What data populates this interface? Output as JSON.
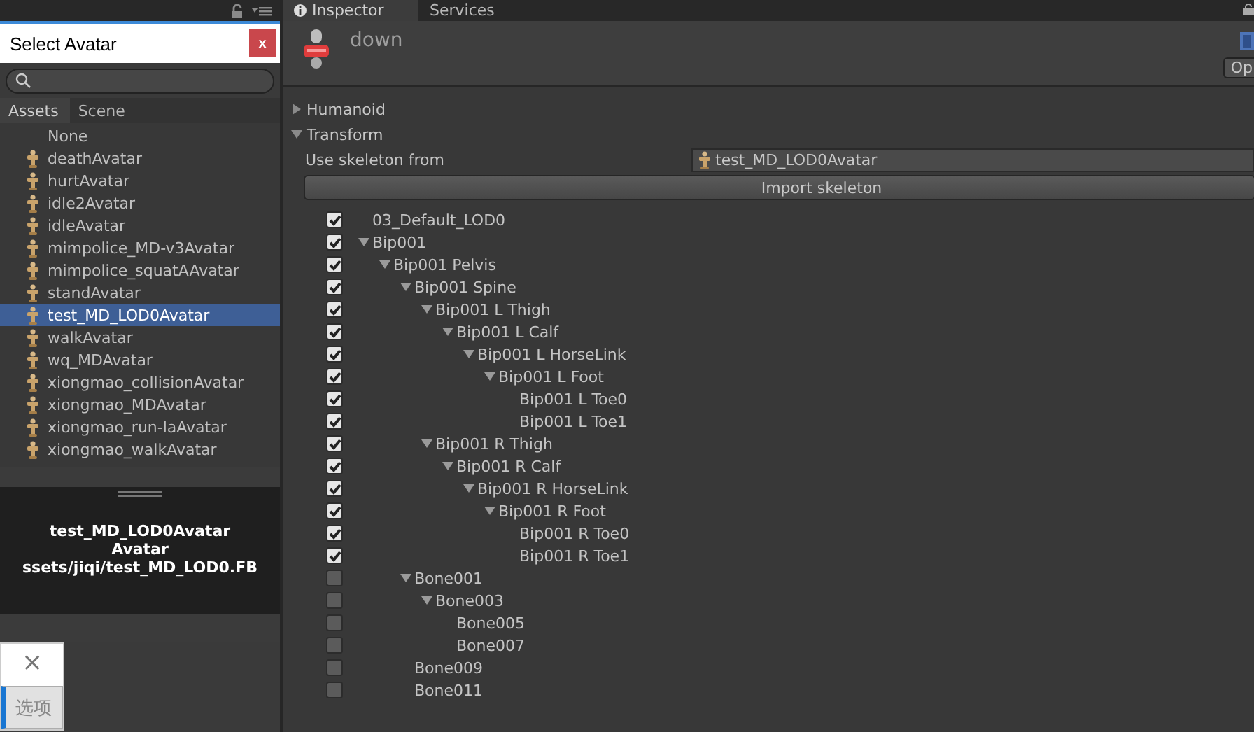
{
  "picker": {
    "title": "Select Avatar",
    "close": "x",
    "tabs": [
      {
        "label": "Assets",
        "selected": true
      },
      {
        "label": "Scene",
        "selected": false
      }
    ],
    "items": [
      {
        "label": "None",
        "kind": "none",
        "selected": false
      },
      {
        "label": "deathAvatar",
        "kind": "avatar",
        "selected": false
      },
      {
        "label": "hurtAvatar",
        "kind": "avatar",
        "selected": false
      },
      {
        "label": "idle2Avatar",
        "kind": "avatar",
        "selected": false
      },
      {
        "label": "idleAvatar",
        "kind": "avatar",
        "selected": false
      },
      {
        "label": "mimpolice_MD-v3Avatar",
        "kind": "avatar",
        "selected": false
      },
      {
        "label": "mimpolice_squatAAvatar",
        "kind": "avatar",
        "selected": false
      },
      {
        "label": "standAvatar",
        "kind": "avatar",
        "selected": false
      },
      {
        "label": "test_MD_LOD0Avatar",
        "kind": "avatar",
        "selected": true
      },
      {
        "label": "walkAvatar",
        "kind": "avatar",
        "selected": false
      },
      {
        "label": "wq_MDAvatar",
        "kind": "avatar",
        "selected": false
      },
      {
        "label": "xiongmao_collisionAvatar",
        "kind": "avatar",
        "selected": false
      },
      {
        "label": "xiongmao_MDAvatar",
        "kind": "avatar",
        "selected": false
      },
      {
        "label": "xiongmao_run-laAvatar",
        "kind": "avatar",
        "selected": false
      },
      {
        "label": "xiongmao_walkAvatar",
        "kind": "avatar",
        "selected": false
      }
    ],
    "preview": [
      "test_MD_LOD0Avatar",
      "Avatar",
      "ssets/jiqi/test_MD_LOD0.FB"
    ]
  },
  "dialog": {
    "close": "×",
    "button": "选项"
  },
  "tabs": [
    {
      "label": "Inspector",
      "selected": true
    },
    {
      "label": "Services",
      "selected": false
    }
  ],
  "header": {
    "title": "down",
    "button": "Op"
  },
  "sections": [
    {
      "label": "Humanoid",
      "expanded": false
    },
    {
      "label": "Transform",
      "expanded": true
    }
  ],
  "skeleton_label": "Use skeleton from",
  "skeleton_value": "test_MD_LOD0Avatar",
  "import_button": "Import skeleton",
  "tree": [
    {
      "label": "03_Default_LOD0",
      "checked": true
    },
    {
      "label": "Bip001",
      "checked": true,
      "expanded": true,
      "children": [
        {
          "label": "Bip001 Pelvis",
          "checked": true,
          "expanded": true,
          "children": [
            {
              "label": "Bip001 Spine",
              "checked": true,
              "expanded": true,
              "children": [
                {
                  "label": "Bip001 L Thigh",
                  "checked": true,
                  "expanded": true,
                  "children": [
                    {
                      "label": "Bip001 L Calf",
                      "checked": true,
                      "expanded": true,
                      "children": [
                        {
                          "label": "Bip001 L HorseLink",
                          "checked": true,
                          "expanded": true,
                          "children": [
                            {
                              "label": "Bip001 L Foot",
                              "checked": true,
                              "expanded": true,
                              "children": [
                                {
                                  "label": "Bip001 L Toe0",
                                  "checked": true
                                },
                                {
                                  "label": "Bip001 L Toe1",
                                  "checked": true
                                }
                              ]
                            }
                          ]
                        }
                      ]
                    }
                  ]
                },
                {
                  "label": "Bip001 R Thigh",
                  "checked": true,
                  "expanded": true,
                  "children": [
                    {
                      "label": "Bip001 R Calf",
                      "checked": true,
                      "expanded": true,
                      "children": [
                        {
                          "label": "Bip001 R HorseLink",
                          "checked": true,
                          "expanded": true,
                          "children": [
                            {
                              "label": "Bip001 R Foot",
                              "checked": true,
                              "expanded": true,
                              "children": [
                                {
                                  "label": "Bip001 R Toe0",
                                  "checked": true
                                },
                                {
                                  "label": "Bip001 R Toe1",
                                  "checked": true
                                }
                              ]
                            }
                          ]
                        }
                      ]
                    }
                  ]
                }
              ]
            },
            {
              "label": "Bone001",
              "checked": false,
              "expanded": true,
              "children": [
                {
                  "label": "Bone003",
                  "checked": false,
                  "expanded": true,
                  "children": [
                    {
                      "label": "Bone005",
                      "checked": false
                    },
                    {
                      "label": "Bone007",
                      "checked": false
                    }
                  ]
                }
              ]
            },
            {
              "label": "Bone009",
              "checked": false
            },
            {
              "label": "Bone011",
              "checked": false
            }
          ]
        }
      ]
    }
  ]
}
